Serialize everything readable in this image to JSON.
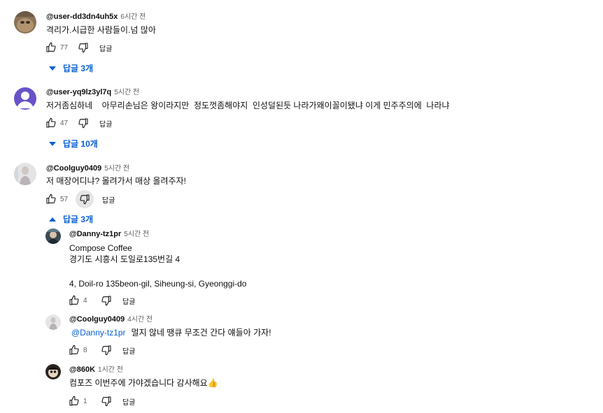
{
  "comments": [
    {
      "author": "@user-dd3dn4uh5x",
      "time": "6시간 전",
      "text": "격리가.시급한 사람들이.넘 많아",
      "likes": "77",
      "reply_label": "답글",
      "replies_toggle": "답글 3개",
      "avatar": "cat-photo"
    },
    {
      "author": "@user-yq9lz3yl7q",
      "time": "5시간 전",
      "text": "저거좀심하네    아무리손님은 왕이라지만  정도껏좀해야지  인성덜된듯 나라가왜이꼴이됐냐 이게 민주주의에  나라냐",
      "likes": "47",
      "reply_label": "답글",
      "replies_toggle": "답글 10개",
      "avatar": "default-purple",
      "avatar_color": "#6a52c9"
    },
    {
      "author": "@Coolguy0409",
      "time": "5시간 전",
      "text": "저 매장어디냐? 몰려가서 매상 올려주자!",
      "likes": "57",
      "reply_label": "답글",
      "replies_toggle": "답글 3개",
      "avatar": "figure-photo"
    }
  ],
  "replies": [
    {
      "author": "@Danny-tz1pr",
      "time": "5시간 전",
      "lines": [
        "Compose Coffee",
        "경기도 시흥시 도일로135번길 4",
        "",
        "4, Doil-ro 135beon-gil, Siheung-si, Gyeonggi-do"
      ],
      "likes": "4",
      "reply_label": "답글"
    },
    {
      "author": "@Coolguy0409",
      "time": "4시간 전",
      "mention": "@Danny-tz1pr",
      "text": "멀지 않네 땡큐 무조건 간다 얘들아 가자!",
      "likes": "8",
      "reply_label": "답글"
    },
    {
      "author": "@860K",
      "time": "1시간 전",
      "text": "컴포즈 이번주에 가야겠습니다 감사해요👍",
      "likes": "1",
      "reply_label": "답글"
    }
  ],
  "colors": {
    "link": "#065fd4",
    "secondary": "#606060",
    "active_bg": "#e5e5e5"
  }
}
